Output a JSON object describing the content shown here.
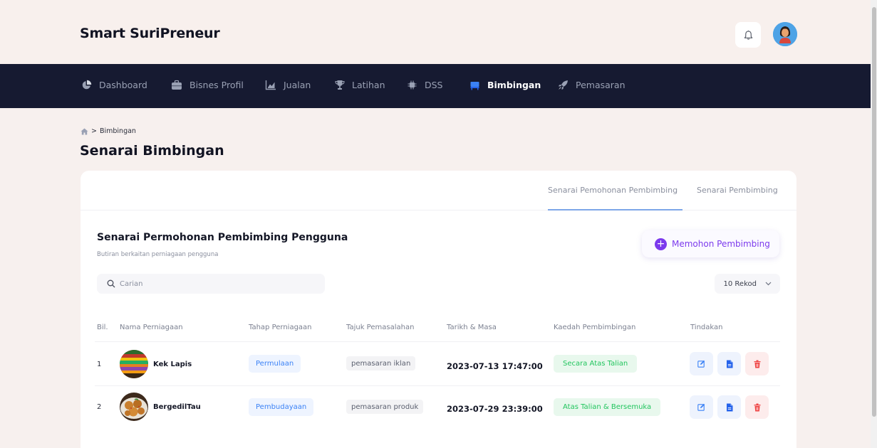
{
  "app": {
    "brand": "Smart SuriPreneur"
  },
  "colors": {
    "navbar": "#161a31",
    "accent": "#7c3aed",
    "page_bg": "#f7f0ee"
  },
  "nav": {
    "items": [
      {
        "label": "Dashboard",
        "icon": "pie-chart-icon",
        "active": false
      },
      {
        "label": "Bisnes Profil",
        "icon": "briefcase-icon",
        "active": false
      },
      {
        "label": "Jualan",
        "icon": "bar-chart-icon",
        "active": false
      },
      {
        "label": "Latihan",
        "icon": "trophy-icon",
        "active": false
      },
      {
        "label": "DSS",
        "icon": "chip-icon",
        "active": false
      },
      {
        "label": "Bimbingan",
        "icon": "chair-icon",
        "active": true
      },
      {
        "label": "Pemasaran",
        "icon": "rocket-icon",
        "active": false
      }
    ]
  },
  "breadcrumb": {
    "separator": ">",
    "current": "Bimbingan"
  },
  "page": {
    "title": "Senarai Bimbingan"
  },
  "tabs": [
    {
      "label": "Senarai Pemohonan Pembimbing",
      "active": true
    },
    {
      "label": "Senarai Pembimbing",
      "active": false
    }
  ],
  "section": {
    "title": "Senarai Permohonan Pembimbing Pengguna",
    "subtitle": "Butiran berkaitan perniagaan pengguna",
    "apply_label": "Memohon Pembimbing"
  },
  "search": {
    "placeholder": "Carian",
    "value": ""
  },
  "records": {
    "selected": "10 Rekod"
  },
  "table": {
    "headers": [
      "Bil.",
      "Nama Perniagaan",
      "Tahap Perniagaan",
      "Tajuk Pemasalahan",
      "Tarikh & Masa",
      "Kaedah Pembimbingan",
      "Tindakan"
    ],
    "rows": [
      {
        "no": "1",
        "name": "Kek Lapis",
        "stage": "Permulaan",
        "topic": "pemasaran iklan",
        "datetime": "2023-07-13 17:47:00",
        "method": "Secara Atas Talian"
      },
      {
        "no": "2",
        "name": "BergedilTau",
        "stage": "Pembudayaan",
        "topic": "pemasaran produk",
        "datetime": "2023-07-29 23:39:00",
        "method": "Atas Talian & Bersemuka"
      }
    ]
  }
}
